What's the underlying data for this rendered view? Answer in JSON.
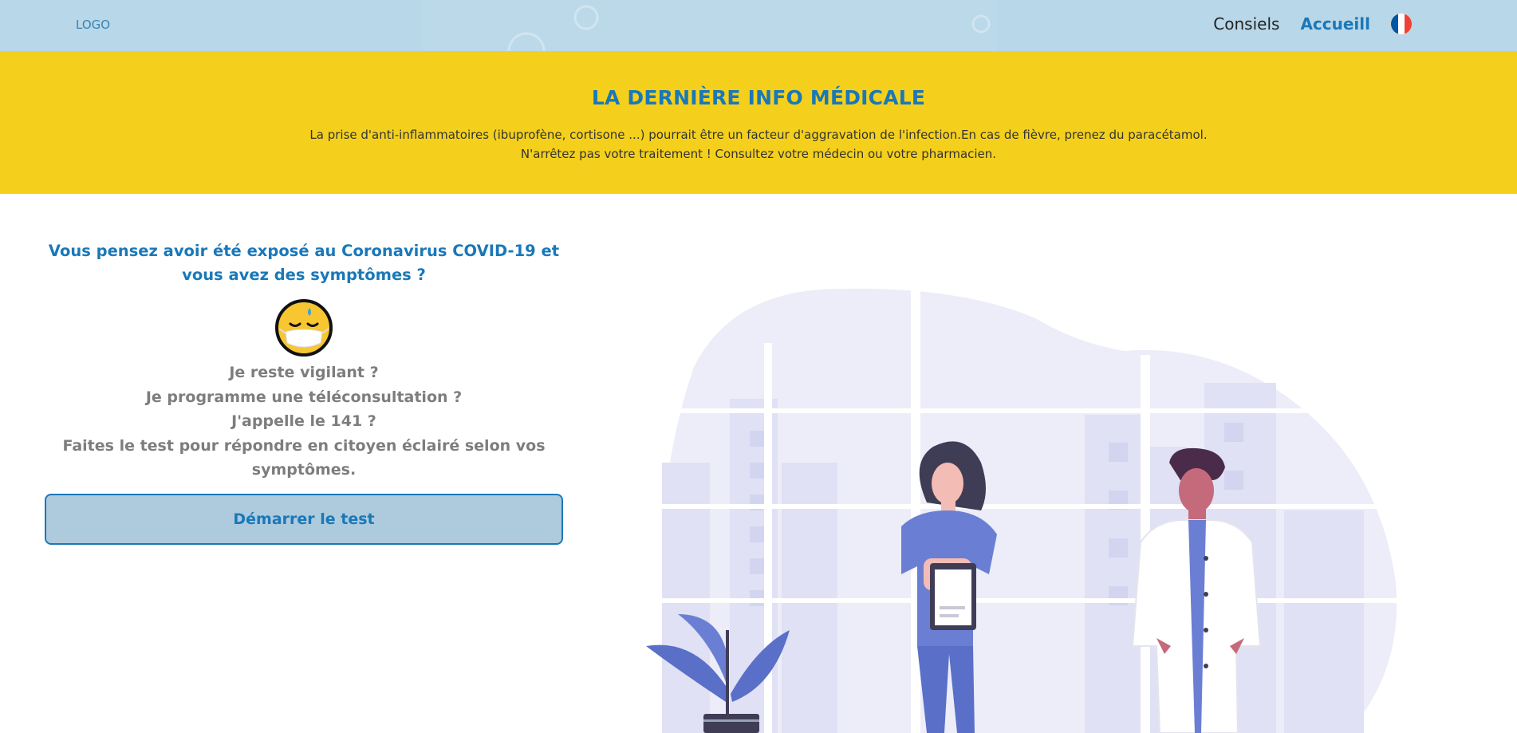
{
  "header": {
    "logo": "LOGO",
    "nav": [
      {
        "label": "Consiels"
      },
      {
        "label": "Accueill"
      }
    ],
    "flag_colors": [
      "#0055a4",
      "#ffffff",
      "#ef4135"
    ]
  },
  "banner": {
    "title": "LA DERNIÈRE INFO MÉDICALE",
    "line1": "La prise d'anti-inflammatoires (ibuprofène, cortisone ...) pourrait être un facteur d'aggravation de l'infection.En cas de fièvre, prenez du paracétamol.",
    "line2": "N'arrêtez pas votre traitement ! Consultez votre médecin ou votre pharmacien."
  },
  "main": {
    "question": "Vous pensez avoir été exposé au Coronavirus COVID-19 et vous avez des symptômes ?",
    "lines": [
      "Je reste vigilant ?",
      "Je programme une téléconsultation ?",
      "J'appelle le 141 ?",
      "Faites le test pour répondre en citoyen éclairé selon vos symptômes."
    ],
    "button": "Démarrer le test"
  },
  "colors": {
    "topbar": "#b8d7e8",
    "banner": "#f4d01c",
    "accent": "#1a78b8",
    "muted_text": "#7d7d7d",
    "illustration_primary": "#6a7fd4"
  },
  "icons": {
    "emoji": "masked-face-sweat-icon",
    "flag": "france-flag-icon"
  }
}
